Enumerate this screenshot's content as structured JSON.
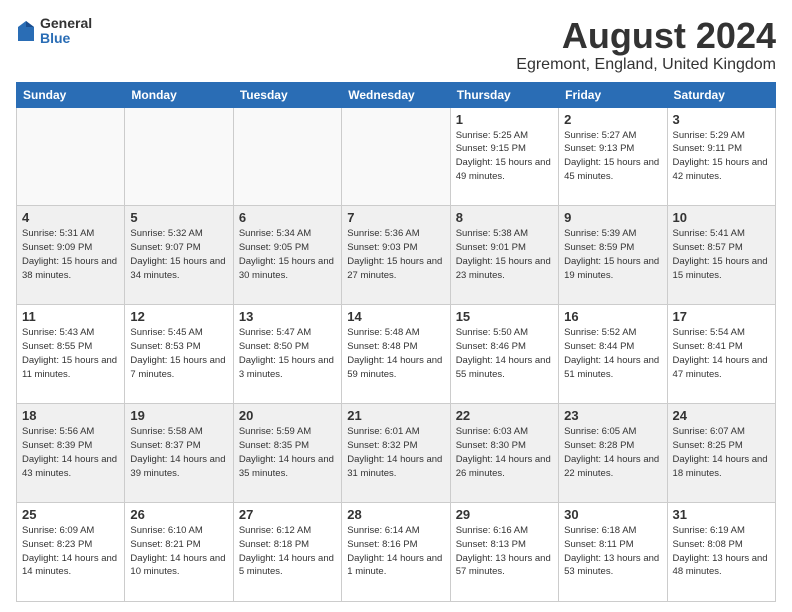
{
  "header": {
    "logo_general": "General",
    "logo_blue": "Blue",
    "main_title": "August 2024",
    "subtitle": "Egremont, England, United Kingdom"
  },
  "columns": [
    "Sunday",
    "Monday",
    "Tuesday",
    "Wednesday",
    "Thursday",
    "Friday",
    "Saturday"
  ],
  "weeks": [
    {
      "shaded": false,
      "days": [
        {
          "num": "",
          "info": ""
        },
        {
          "num": "",
          "info": ""
        },
        {
          "num": "",
          "info": ""
        },
        {
          "num": "",
          "info": ""
        },
        {
          "num": "1",
          "info": "Sunrise: 5:25 AM\nSunset: 9:15 PM\nDaylight: 15 hours\nand 49 minutes."
        },
        {
          "num": "2",
          "info": "Sunrise: 5:27 AM\nSunset: 9:13 PM\nDaylight: 15 hours\nand 45 minutes."
        },
        {
          "num": "3",
          "info": "Sunrise: 5:29 AM\nSunset: 9:11 PM\nDaylight: 15 hours\nand 42 minutes."
        }
      ]
    },
    {
      "shaded": true,
      "days": [
        {
          "num": "4",
          "info": "Sunrise: 5:31 AM\nSunset: 9:09 PM\nDaylight: 15 hours\nand 38 minutes."
        },
        {
          "num": "5",
          "info": "Sunrise: 5:32 AM\nSunset: 9:07 PM\nDaylight: 15 hours\nand 34 minutes."
        },
        {
          "num": "6",
          "info": "Sunrise: 5:34 AM\nSunset: 9:05 PM\nDaylight: 15 hours\nand 30 minutes."
        },
        {
          "num": "7",
          "info": "Sunrise: 5:36 AM\nSunset: 9:03 PM\nDaylight: 15 hours\nand 27 minutes."
        },
        {
          "num": "8",
          "info": "Sunrise: 5:38 AM\nSunset: 9:01 PM\nDaylight: 15 hours\nand 23 minutes."
        },
        {
          "num": "9",
          "info": "Sunrise: 5:39 AM\nSunset: 8:59 PM\nDaylight: 15 hours\nand 19 minutes."
        },
        {
          "num": "10",
          "info": "Sunrise: 5:41 AM\nSunset: 8:57 PM\nDaylight: 15 hours\nand 15 minutes."
        }
      ]
    },
    {
      "shaded": false,
      "days": [
        {
          "num": "11",
          "info": "Sunrise: 5:43 AM\nSunset: 8:55 PM\nDaylight: 15 hours\nand 11 minutes."
        },
        {
          "num": "12",
          "info": "Sunrise: 5:45 AM\nSunset: 8:53 PM\nDaylight: 15 hours\nand 7 minutes."
        },
        {
          "num": "13",
          "info": "Sunrise: 5:47 AM\nSunset: 8:50 PM\nDaylight: 15 hours\nand 3 minutes."
        },
        {
          "num": "14",
          "info": "Sunrise: 5:48 AM\nSunset: 8:48 PM\nDaylight: 14 hours\nand 59 minutes."
        },
        {
          "num": "15",
          "info": "Sunrise: 5:50 AM\nSunset: 8:46 PM\nDaylight: 14 hours\nand 55 minutes."
        },
        {
          "num": "16",
          "info": "Sunrise: 5:52 AM\nSunset: 8:44 PM\nDaylight: 14 hours\nand 51 minutes."
        },
        {
          "num": "17",
          "info": "Sunrise: 5:54 AM\nSunset: 8:41 PM\nDaylight: 14 hours\nand 47 minutes."
        }
      ]
    },
    {
      "shaded": true,
      "days": [
        {
          "num": "18",
          "info": "Sunrise: 5:56 AM\nSunset: 8:39 PM\nDaylight: 14 hours\nand 43 minutes."
        },
        {
          "num": "19",
          "info": "Sunrise: 5:58 AM\nSunset: 8:37 PM\nDaylight: 14 hours\nand 39 minutes."
        },
        {
          "num": "20",
          "info": "Sunrise: 5:59 AM\nSunset: 8:35 PM\nDaylight: 14 hours\nand 35 minutes."
        },
        {
          "num": "21",
          "info": "Sunrise: 6:01 AM\nSunset: 8:32 PM\nDaylight: 14 hours\nand 31 minutes."
        },
        {
          "num": "22",
          "info": "Sunrise: 6:03 AM\nSunset: 8:30 PM\nDaylight: 14 hours\nand 26 minutes."
        },
        {
          "num": "23",
          "info": "Sunrise: 6:05 AM\nSunset: 8:28 PM\nDaylight: 14 hours\nand 22 minutes."
        },
        {
          "num": "24",
          "info": "Sunrise: 6:07 AM\nSunset: 8:25 PM\nDaylight: 14 hours\nand 18 minutes."
        }
      ]
    },
    {
      "shaded": false,
      "days": [
        {
          "num": "25",
          "info": "Sunrise: 6:09 AM\nSunset: 8:23 PM\nDaylight: 14 hours\nand 14 minutes."
        },
        {
          "num": "26",
          "info": "Sunrise: 6:10 AM\nSunset: 8:21 PM\nDaylight: 14 hours\nand 10 minutes."
        },
        {
          "num": "27",
          "info": "Sunrise: 6:12 AM\nSunset: 8:18 PM\nDaylight: 14 hours\nand 5 minutes."
        },
        {
          "num": "28",
          "info": "Sunrise: 6:14 AM\nSunset: 8:16 PM\nDaylight: 14 hours\nand 1 minute."
        },
        {
          "num": "29",
          "info": "Sunrise: 6:16 AM\nSunset: 8:13 PM\nDaylight: 13 hours\nand 57 minutes."
        },
        {
          "num": "30",
          "info": "Sunrise: 6:18 AM\nSunset: 8:11 PM\nDaylight: 13 hours\nand 53 minutes."
        },
        {
          "num": "31",
          "info": "Sunrise: 6:19 AM\nSunset: 8:08 PM\nDaylight: 13 hours\nand 48 minutes."
        }
      ]
    }
  ]
}
